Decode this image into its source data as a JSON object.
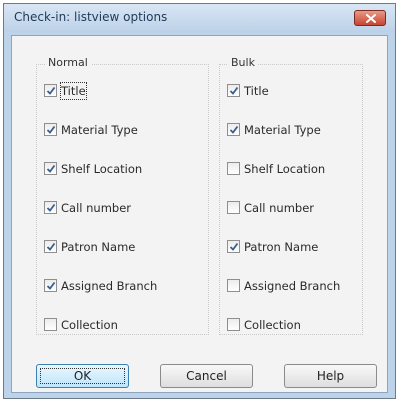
{
  "window": {
    "title": "Check-in: listview options",
    "close_icon": "close-icon"
  },
  "normal": {
    "title": "Normal",
    "options": [
      {
        "label": "Title",
        "checked": true
      },
      {
        "label": "Material Type",
        "checked": true
      },
      {
        "label": "Shelf Location",
        "checked": true
      },
      {
        "label": "Call number",
        "checked": true
      },
      {
        "label": "Patron Name",
        "checked": true
      },
      {
        "label": "Assigned Branch",
        "checked": true
      },
      {
        "label": "Collection",
        "checked": false
      }
    ]
  },
  "bulk": {
    "title": "Bulk",
    "options": [
      {
        "label": "Title",
        "checked": true
      },
      {
        "label": "Material Type",
        "checked": true
      },
      {
        "label": "Shelf Location",
        "checked": false
      },
      {
        "label": "Call number",
        "checked": false
      },
      {
        "label": "Patron Name",
        "checked": true
      },
      {
        "label": "Assigned Branch",
        "checked": false
      },
      {
        "label": "Collection",
        "checked": false
      }
    ]
  },
  "buttons": {
    "ok": "OK",
    "cancel": "Cancel",
    "help": "Help"
  }
}
